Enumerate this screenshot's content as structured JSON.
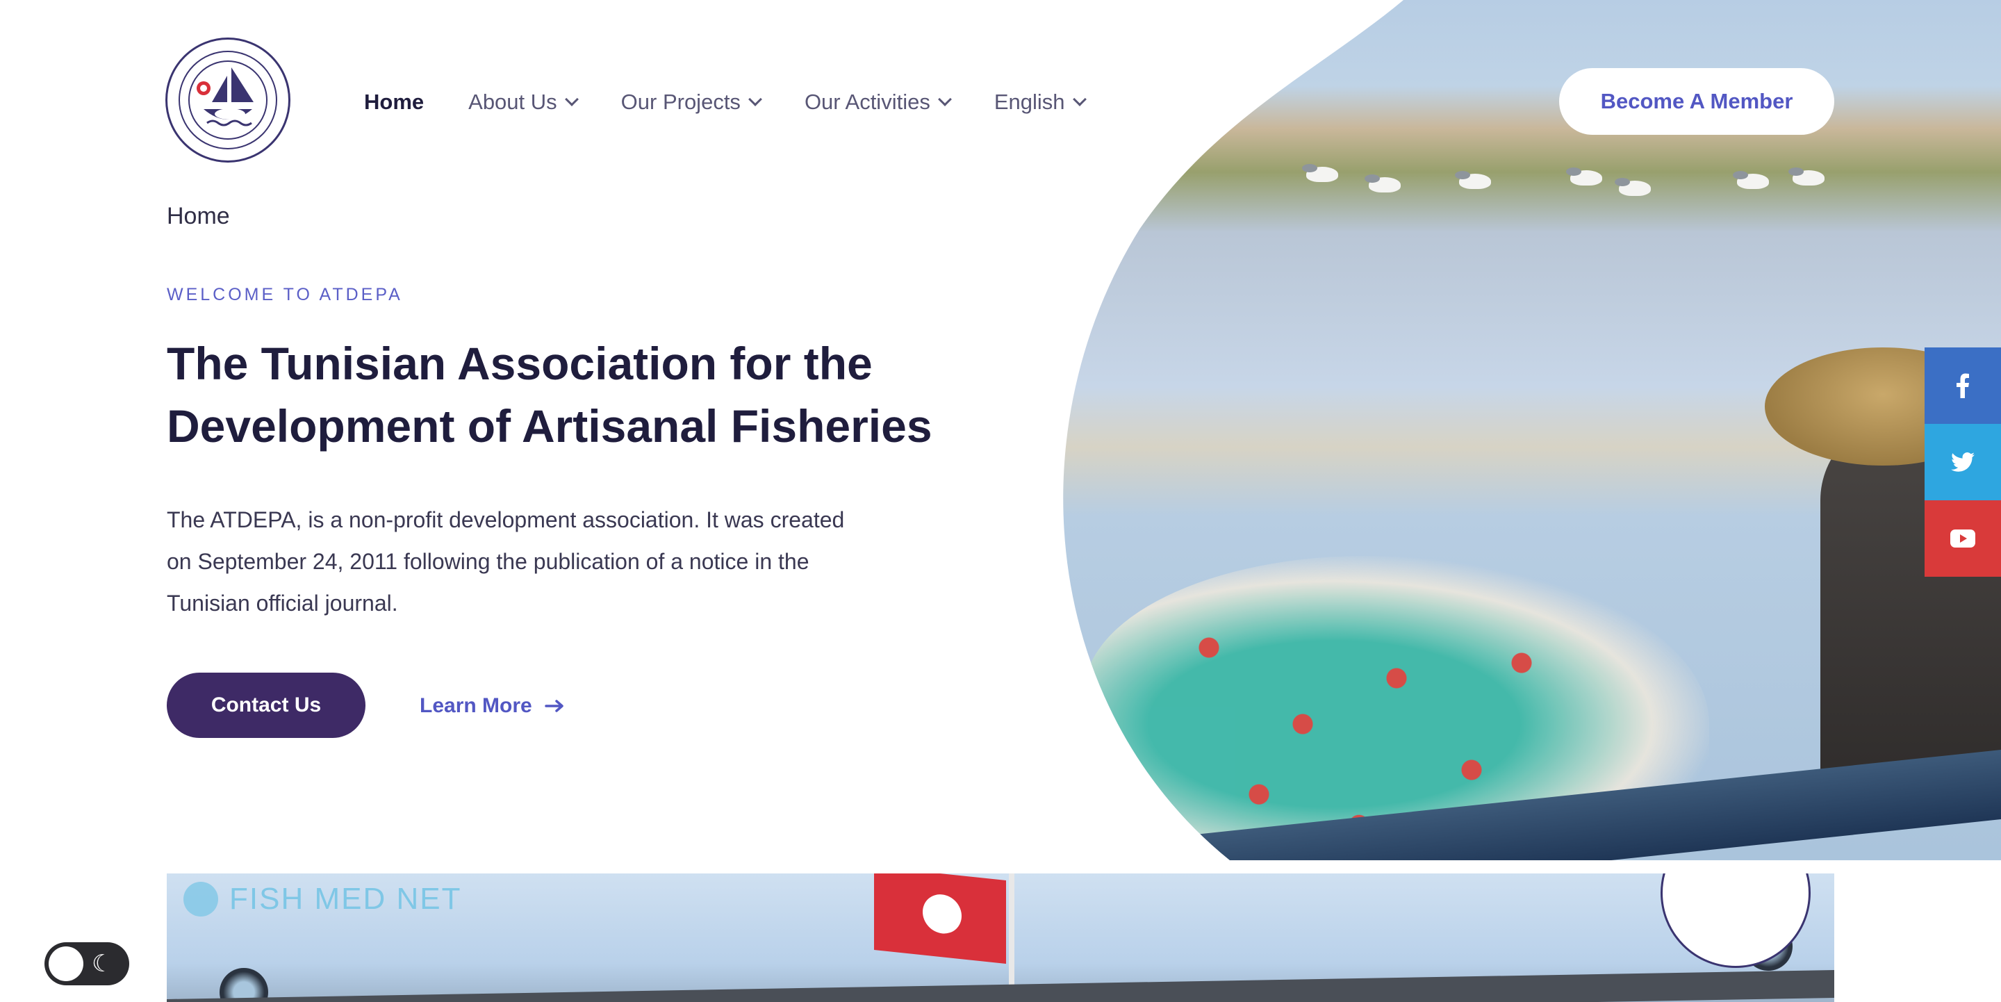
{
  "header": {
    "logo_alt": "ATDEPA logo",
    "nav": [
      {
        "label": "Home",
        "active": true,
        "has_dropdown": false
      },
      {
        "label": "About Us",
        "active": false,
        "has_dropdown": true
      },
      {
        "label": "Our Projects",
        "active": false,
        "has_dropdown": true
      },
      {
        "label": "Our Activities",
        "active": false,
        "has_dropdown": true
      },
      {
        "label": "English",
        "active": false,
        "has_dropdown": true
      }
    ],
    "cta_label": "Become A Member"
  },
  "breadcrumb": "Home",
  "hero": {
    "eyebrow": "WELCOME TO ATDEPA",
    "title": "The Tunisian Association for the Development of Artisanal Fisheries",
    "description": "The ATDEPA, is a non-profit development association. It was created on September 24, 2011 following the publication of a notice in the Tunisian official journal.",
    "primary_button": "Contact Us",
    "secondary_link": "Learn More"
  },
  "social": [
    {
      "icon": "facebook-icon",
      "color": "#3b6fc5"
    },
    {
      "icon": "twitter-icon",
      "color": "#2ea6e0"
    },
    {
      "icon": "youtube-icon",
      "color": "#d93a3a"
    }
  ],
  "banner": {
    "label": "FISH MED NET"
  },
  "theme_toggle": {
    "icon": "moon-icon"
  },
  "colors": {
    "accent": "#5257c3",
    "primary_button": "#3e2a66",
    "heading": "#1f1d3d"
  }
}
